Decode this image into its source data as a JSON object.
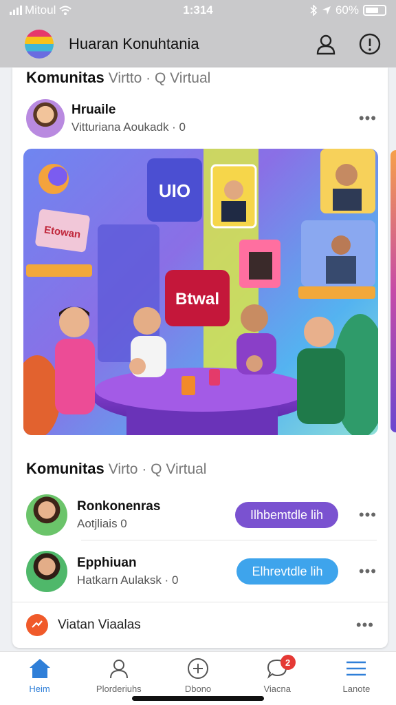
{
  "status_bar": {
    "carrier": "Mitoul",
    "time": "1:314",
    "battery": "60%"
  },
  "header": {
    "title": "Huaran Konuhtania"
  },
  "section1": {
    "title": "Komunitas",
    "subtitle": "Virtto · Q Virtual"
  },
  "post": {
    "author": "Hruaile",
    "meta": "Vitturiana Aoukadk · 0"
  },
  "hero": {
    "badge_text": "Btwal",
    "sign_text": "Etowan",
    "tile_text": "UIO"
  },
  "section2": {
    "title": "Komunitas",
    "subtitle": "Virto · Q Virtual",
    "items": [
      {
        "name": "Ronkonenras",
        "meta": "Aotjliais  0",
        "button": "Ilhbemtdle lih",
        "button_color": "#7a52d0"
      },
      {
        "name": "Epphiuan",
        "meta": "Hatkarn Aulaksk · 0",
        "button": "Elhrevtdle lih",
        "button_color": "#3ea4ec"
      }
    ]
  },
  "footer_row": {
    "label": "Viatan Viaalas"
  },
  "bottom_nav": {
    "items": [
      {
        "label": "Heim"
      },
      {
        "label": "Plorderiuhs"
      },
      {
        "label": "Dbono"
      },
      {
        "label": "Viacna",
        "badge": "2"
      },
      {
        "label": "Lanote"
      }
    ]
  },
  "colors": {
    "accent": "#2f7fd8",
    "header_bg": "#c9c9cb",
    "pill_purple": "#7a52d0",
    "pill_blue": "#3ea4ec"
  }
}
